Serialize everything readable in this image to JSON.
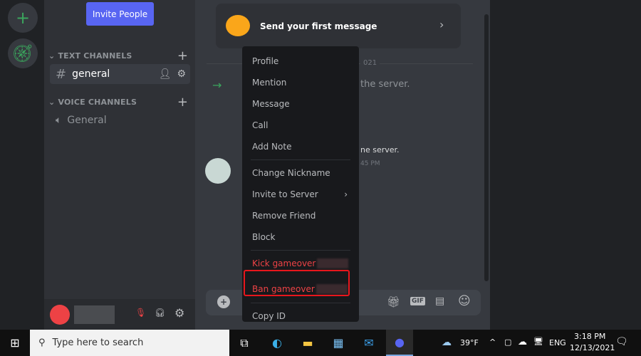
{
  "sidebar": {
    "invite_label": "Invite People",
    "text_category": "TEXT CHANNELS",
    "voice_category": "VOICE CHANNELS",
    "text_channels": [
      {
        "name": "general"
      }
    ],
    "voice_channels": [
      {
        "name": "General"
      }
    ]
  },
  "chat": {
    "cta_label": "Send your first message",
    "date_fragment": "021",
    "msg1_fragment": "the server.",
    "msg2_fragment": "ne server.",
    "time_fragment": "45 PM",
    "gif_label": "GIF"
  },
  "menu": {
    "items": [
      "Profile",
      "Mention",
      "Message",
      "Call",
      "Add Note",
      "Change Nickname",
      "Invite to Server",
      "Remove Friend",
      "Block",
      "Kick gameover",
      "Ban gameover",
      "Copy ID"
    ]
  },
  "taskbar": {
    "search_placeholder": "Type here to search",
    "weather": "39°F",
    "language": "ENG",
    "time": "3:18 PM",
    "date": "12/13/2021"
  },
  "colors": {
    "accent": "#5865f2",
    "danger": "#ed4245",
    "highlight": "#e8161c",
    "online": "#3ba55d"
  }
}
